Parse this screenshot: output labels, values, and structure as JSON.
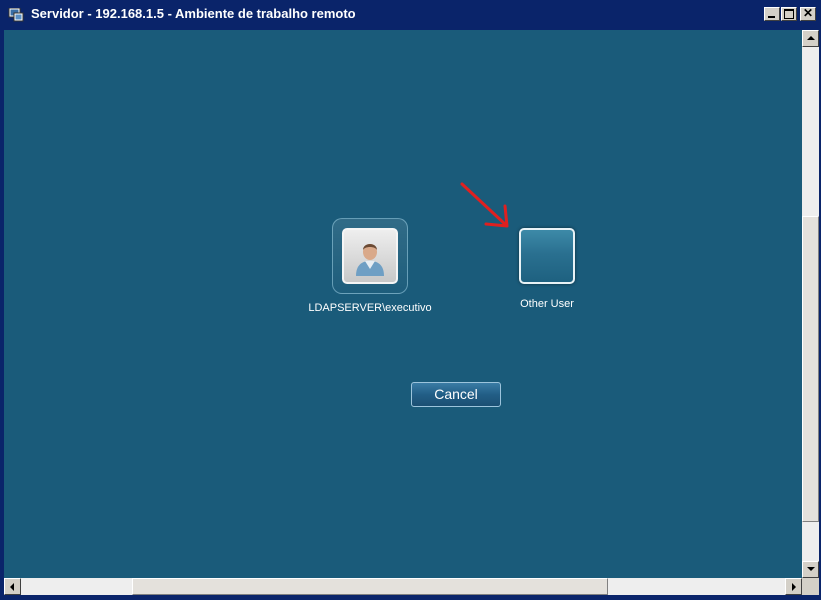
{
  "window": {
    "title": "Servidor - 192.168.1.5 - Ambiente de trabalho remoto",
    "icon": "remote-desktop-icon",
    "minimize_icon": "minimize-icon",
    "maximize_icon": "maximize-icon",
    "close_symbol": "✕"
  },
  "login_screen": {
    "background_color": "#1a5b7a",
    "users": [
      {
        "label": "LDAPSERVER\\executivo",
        "icon": "user-avatar-icon",
        "selected": true
      },
      {
        "label": "Other User",
        "icon": "blank-avatar-tile"
      }
    ],
    "cancel_label": "Cancel"
  },
  "annotation": {
    "icon": "red-arrow-icon",
    "color": "#e02020",
    "points_to": "Other User"
  }
}
